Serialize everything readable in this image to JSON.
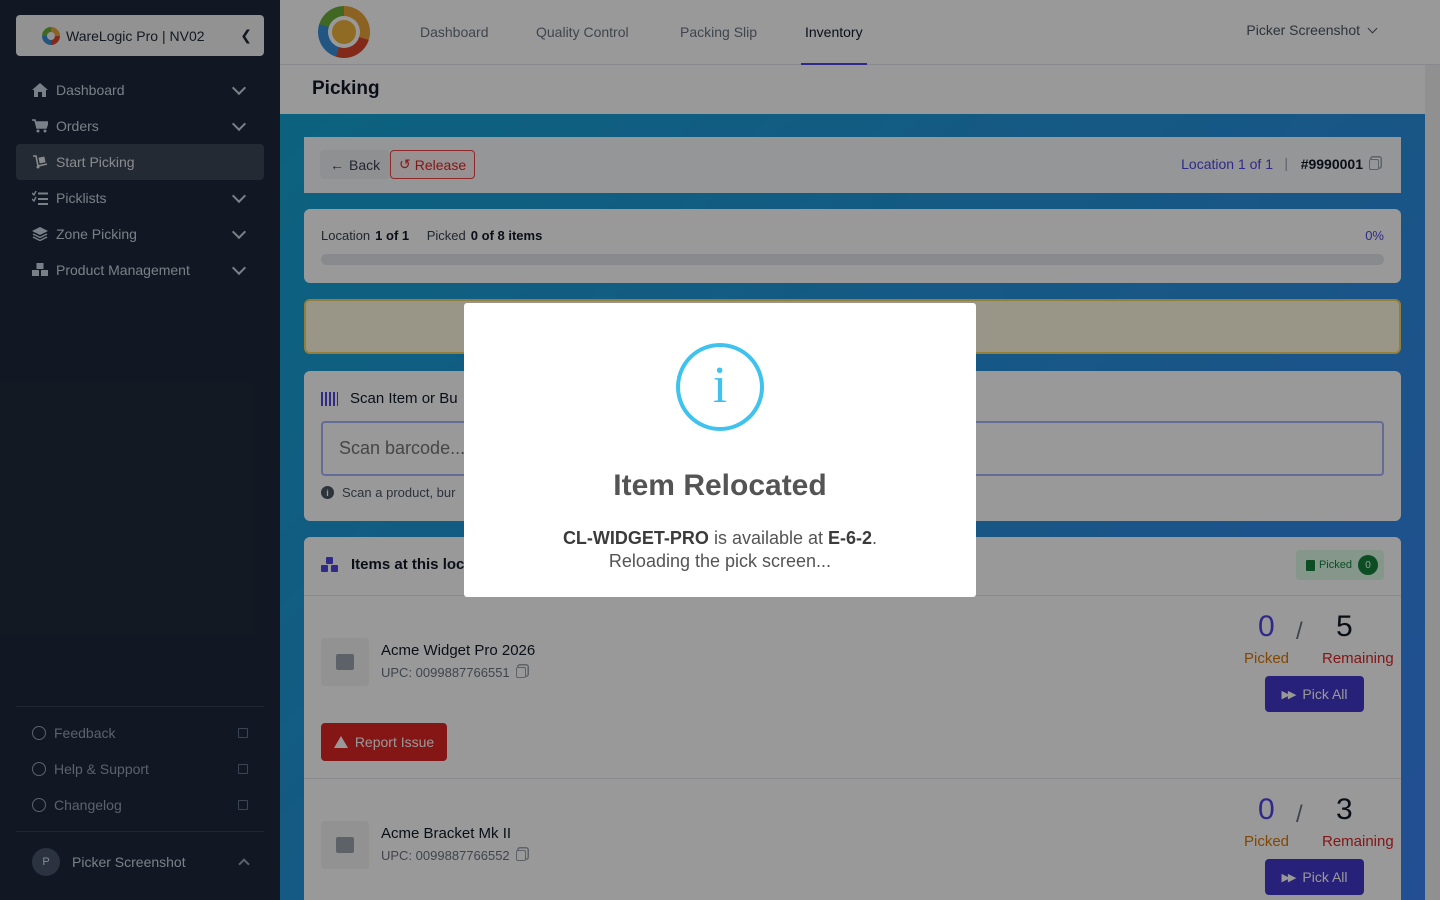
{
  "sidebar": {
    "brand": "WareLogic Pro | NV02",
    "items": [
      {
        "label": "Dashboard",
        "icon": "home-icon",
        "expandable": true
      },
      {
        "label": "Orders",
        "icon": "cart-icon",
        "expandable": true
      },
      {
        "label": "Start Picking",
        "icon": "dolly-icon",
        "expandable": false,
        "active": true
      },
      {
        "label": "Picklists",
        "icon": "list-check-icon",
        "expandable": true
      },
      {
        "label": "Zone Picking",
        "icon": "layers-icon",
        "expandable": true
      },
      {
        "label": "Product Management",
        "icon": "cubes-icon",
        "expandable": true
      }
    ],
    "footer": [
      {
        "label": "Feedback",
        "icon": "comment-icon"
      },
      {
        "label": "Help & Support",
        "icon": "question-icon"
      },
      {
        "label": "Changelog",
        "icon": "history-icon"
      }
    ],
    "user": {
      "initial": "P",
      "name": "Picker Screenshot"
    }
  },
  "topbar": {
    "tabs": [
      "Dashboard",
      "Quality Control",
      "Packing Slip",
      "Inventory"
    ],
    "active_tab": "Inventory",
    "user_menu": "Picker Screenshot"
  },
  "page": {
    "title": "Picking"
  },
  "header_card": {
    "back": "Back",
    "release": "Release",
    "location_link": "Location 1 of 1",
    "order_number": "#9990001"
  },
  "progress": {
    "location_label": "Location",
    "location_value": "1 of 1",
    "picked_label": "Picked",
    "picked_value": "0 of 8 items",
    "percent_text": "0%",
    "percent": 0
  },
  "scan": {
    "title": "Scan Item or Bu",
    "placeholder": "Scan barcode...",
    "hint": "Scan a product, bur"
  },
  "items_card": {
    "title": "Items at this loc",
    "picked_badge": "Picked",
    "picked_count": "0",
    "items": [
      {
        "name": "Acme Widget Pro 2026",
        "upc": "UPC: 0099887766551",
        "picked": "0",
        "remaining": "5",
        "picked_label": "Picked",
        "remaining_label": "Remaining",
        "pick_all": "Pick All",
        "report": "Report Issue"
      },
      {
        "name": "Acme Bracket Mk II",
        "upc": "UPC: 0099887766552",
        "picked": "0",
        "remaining": "3",
        "picked_label": "Picked",
        "remaining_label": "Remaining",
        "pick_all": "Pick All"
      }
    ]
  },
  "modal": {
    "icon": "info-icon",
    "icon_glyph": "i",
    "title": "Item Relocated",
    "sku": "CL-WIDGET-PRO",
    "text_mid": " is available at ",
    "location": "E-6-2",
    "text_end": ".",
    "line2": "Reloading the pick screen..."
  },
  "colors": {
    "sidebar_bg": "#1e293b",
    "accent": "#4f46e5",
    "danger": "#dc2626",
    "modal_icon": "#3fc3ee"
  }
}
